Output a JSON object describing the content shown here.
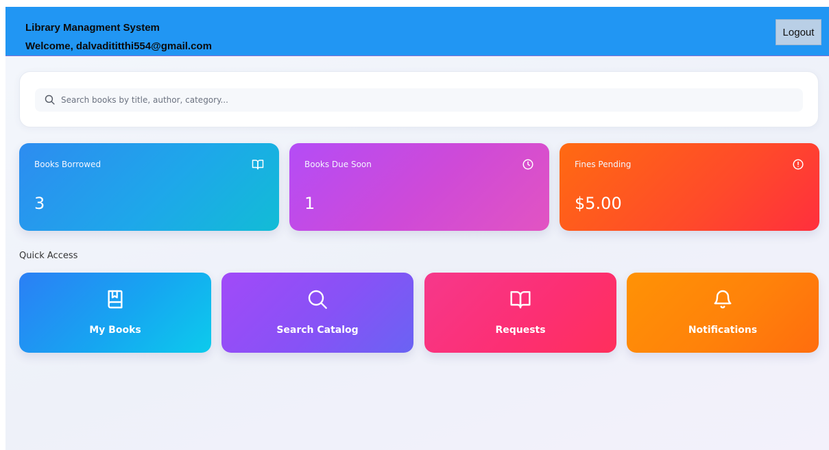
{
  "header": {
    "app_title": "Library Managment System",
    "welcome_text": "Welcome, dalvadititthi554@gmail.com",
    "logout_label": "Logout",
    "background_color": "#2196f3"
  },
  "search": {
    "placeholder": "Search books by title, author, category...",
    "value": "",
    "icon": "search-icon"
  },
  "stats": [
    {
      "label": "Books Borrowed",
      "value": "3",
      "icon": "open-book-icon",
      "color": "#1ea7ea"
    },
    {
      "label": "Books Due Soon",
      "value": "1",
      "icon": "clock-icon",
      "color": "#cf4ad7"
    },
    {
      "label": "Fines Pending",
      "value": "$5.00",
      "icon": "alert-circle-icon",
      "color": "#ff4a2a"
    }
  ],
  "quick_access": {
    "title": "Quick Access",
    "tiles": [
      {
        "label": "My Books",
        "icon": "bookmark-book-icon",
        "color": "#16a6f1"
      },
      {
        "label": "Search Catalog",
        "icon": "search-icon",
        "color": "#8752f6"
      },
      {
        "label": "Requests",
        "icon": "open-book-icon",
        "color": "#fc2f74"
      },
      {
        "label": "Notifications",
        "icon": "bell-icon",
        "color": "#ff820a"
      }
    ]
  }
}
